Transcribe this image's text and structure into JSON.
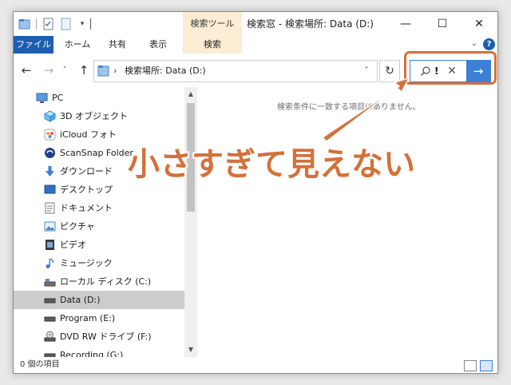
{
  "titlebar": {
    "tool_tab": "検索ツール",
    "title": "検索窓 - 検索場所: Data (D:)",
    "min": "—",
    "max": "☐",
    "close": "✕"
  },
  "ribbon": {
    "file": "ファイル",
    "home": "ホーム",
    "share": "共有",
    "view": "表示",
    "search": "検索",
    "help": "?"
  },
  "nav": {
    "back": "←",
    "forward": "→",
    "recent": "˅",
    "up": "↑"
  },
  "address": {
    "separator": "›",
    "path": "検索場所: Data (D:)",
    "dropdown": "˅",
    "refresh": "↻"
  },
  "search": {
    "query": "!",
    "clear": "✕",
    "go": "→"
  },
  "sidebar": {
    "items": [
      {
        "label": "PC",
        "icon": "pc-icon"
      },
      {
        "label": "3D オブジェクト",
        "icon": "3d-objects-icon"
      },
      {
        "label": "iCloud フォト",
        "icon": "icloud-photos-icon"
      },
      {
        "label": "ScanSnap Folder",
        "icon": "scansnap-icon"
      },
      {
        "label": "ダウンロード",
        "icon": "download-icon"
      },
      {
        "label": "デスクトップ",
        "icon": "desktop-icon"
      },
      {
        "label": "ドキュメント",
        "icon": "documents-icon"
      },
      {
        "label": "ピクチャ",
        "icon": "pictures-icon"
      },
      {
        "label": "ビデオ",
        "icon": "video-icon"
      },
      {
        "label": "ミュージック",
        "icon": "music-icon"
      },
      {
        "label": "ローカル ディスク (C:)",
        "icon": "local-disk-icon"
      },
      {
        "label": "Data (D:)",
        "icon": "drive-icon",
        "selected": true
      },
      {
        "label": "Program (E:)",
        "icon": "drive-icon"
      },
      {
        "label": "DVD RW ドライブ (F:)",
        "icon": "dvd-drive-icon"
      },
      {
        "label": "Recording (G:)",
        "icon": "drive-icon"
      }
    ]
  },
  "content": {
    "empty_message": "検索条件に一致する項目はありません。"
  },
  "status": {
    "count": "0 個の項目"
  },
  "annotation": {
    "text": "小さすぎて見えない",
    "color": "#d4703a"
  },
  "colors": {
    "accent": "#1e5eb0",
    "search_tools": "#fbecd3",
    "search_go": "#3c7fd4",
    "selection": "#cccccc"
  }
}
